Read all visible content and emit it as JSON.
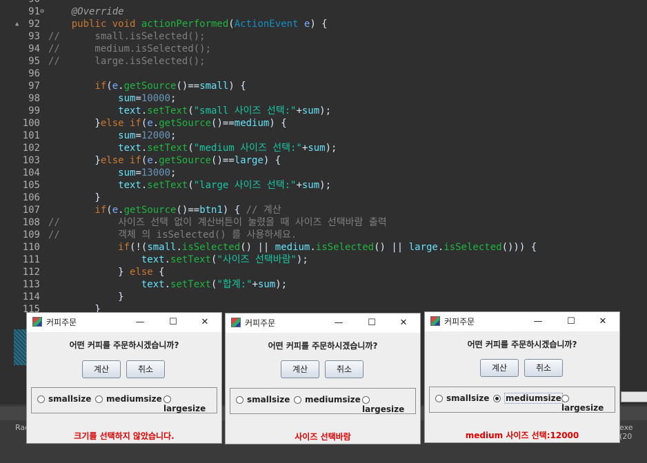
{
  "editor": {
    "lines": [
      {
        "n": "90",
        "tokens": []
      },
      {
        "n": "91",
        "mark": "",
        "fold": "⊖",
        "tokens": [
          [
            "t-ann",
            "    @Override"
          ]
        ]
      },
      {
        "n": "92",
        "mark": "▲",
        "tokens": [
          [
            "t-kw",
            "    public void "
          ],
          [
            "t-method",
            "actionPerformed"
          ],
          [
            "t-plain",
            "("
          ],
          [
            "t-type",
            "ActionEvent"
          ],
          [
            "t-param",
            " e"
          ],
          [
            "t-plain",
            ") {"
          ]
        ]
      },
      {
        "n": "93",
        "tokens": [
          [
            "t-comment",
            "//      small.isSelected();"
          ]
        ]
      },
      {
        "n": "94",
        "tokens": [
          [
            "t-comment",
            "//      medium.isSelected();"
          ]
        ]
      },
      {
        "n": "95",
        "tokens": [
          [
            "t-comment",
            "//      large.isSelected();"
          ]
        ]
      },
      {
        "n": "96",
        "tokens": []
      },
      {
        "n": "97",
        "tokens": [
          [
            "t-kw",
            "        if"
          ],
          [
            "t-plain",
            "("
          ],
          [
            "t-param",
            "e"
          ],
          [
            "t-plain",
            "."
          ],
          [
            "t-method",
            "getSource"
          ],
          [
            "t-plain",
            "()=="
          ],
          [
            "t-field",
            "small"
          ],
          [
            "t-plain",
            ") {"
          ]
        ]
      },
      {
        "n": "98",
        "tokens": [
          [
            "t-field",
            "            sum"
          ],
          [
            "t-plain",
            "="
          ],
          [
            "t-num",
            "10000"
          ],
          [
            "t-plain",
            ";"
          ]
        ]
      },
      {
        "n": "99",
        "tokens": [
          [
            "t-field",
            "            text"
          ],
          [
            "t-plain",
            "."
          ],
          [
            "t-method",
            "setText"
          ],
          [
            "t-plain",
            "("
          ],
          [
            "t-str",
            "\"small 사이즈 선택:\""
          ],
          [
            "t-plain",
            "+"
          ],
          [
            "t-field",
            "sum"
          ],
          [
            "t-plain",
            ");"
          ]
        ]
      },
      {
        "n": "100",
        "tokens": [
          [
            "t-plain",
            "        }"
          ],
          [
            "t-kw",
            "else if"
          ],
          [
            "t-plain",
            "("
          ],
          [
            "t-param",
            "e"
          ],
          [
            "t-plain",
            "."
          ],
          [
            "t-method",
            "getSource"
          ],
          [
            "t-plain",
            "()=="
          ],
          [
            "t-field",
            "medium"
          ],
          [
            "t-plain",
            ") {"
          ]
        ]
      },
      {
        "n": "101",
        "tokens": [
          [
            "t-field",
            "            sum"
          ],
          [
            "t-plain",
            "="
          ],
          [
            "t-num",
            "12000"
          ],
          [
            "t-plain",
            ";"
          ]
        ]
      },
      {
        "n": "102",
        "tokens": [
          [
            "t-field",
            "            text"
          ],
          [
            "t-plain",
            "."
          ],
          [
            "t-method",
            "setText"
          ],
          [
            "t-plain",
            "("
          ],
          [
            "t-str",
            "\"medium 사이즈 선택:\""
          ],
          [
            "t-plain",
            "+"
          ],
          [
            "t-field",
            "sum"
          ],
          [
            "t-plain",
            ");"
          ]
        ]
      },
      {
        "n": "103",
        "tokens": [
          [
            "t-plain",
            "        }"
          ],
          [
            "t-kw",
            "else if"
          ],
          [
            "t-plain",
            "("
          ],
          [
            "t-param",
            "e"
          ],
          [
            "t-plain",
            "."
          ],
          [
            "t-method",
            "getSource"
          ],
          [
            "t-plain",
            "()=="
          ],
          [
            "t-field",
            "large"
          ],
          [
            "t-plain",
            ") {"
          ]
        ]
      },
      {
        "n": "104",
        "tokens": [
          [
            "t-field",
            "            sum"
          ],
          [
            "t-plain",
            "="
          ],
          [
            "t-num",
            "13000"
          ],
          [
            "t-plain",
            ";"
          ]
        ]
      },
      {
        "n": "105",
        "tokens": [
          [
            "t-field",
            "            text"
          ],
          [
            "t-plain",
            "."
          ],
          [
            "t-method",
            "setText"
          ],
          [
            "t-plain",
            "("
          ],
          [
            "t-str",
            "\"large 사이즈 선택:\""
          ],
          [
            "t-plain",
            "+"
          ],
          [
            "t-field",
            "sum"
          ],
          [
            "t-plain",
            ");"
          ]
        ]
      },
      {
        "n": "106",
        "tokens": [
          [
            "t-plain",
            "        }"
          ]
        ]
      },
      {
        "n": "107",
        "tokens": [
          [
            "t-kw",
            "        if"
          ],
          [
            "t-plain",
            "("
          ],
          [
            "t-param",
            "e"
          ],
          [
            "t-plain",
            "."
          ],
          [
            "t-method",
            "getSource"
          ],
          [
            "t-plain",
            "()=="
          ],
          [
            "t-field",
            "btn1"
          ],
          [
            "t-plain",
            ") { "
          ],
          [
            "t-comment",
            "// 계산"
          ]
        ]
      },
      {
        "n": "108",
        "tokens": [
          [
            "t-comment",
            "//          사이즈 선택 없이 계산버튼이 눌렸을 때 사이즈 선택바람 출력"
          ]
        ]
      },
      {
        "n": "109",
        "tokens": [
          [
            "t-comment",
            "//          객체 의 isSelected() 를 사용하세요."
          ]
        ]
      },
      {
        "n": "110",
        "tokens": [
          [
            "t-kw",
            "            if"
          ],
          [
            "t-plain",
            "(!("
          ],
          [
            "t-field",
            "small"
          ],
          [
            "t-plain",
            "."
          ],
          [
            "t-method",
            "isSelected"
          ],
          [
            "t-plain",
            "() || "
          ],
          [
            "t-field",
            "medium"
          ],
          [
            "t-plain",
            "."
          ],
          [
            "t-method",
            "isSelected"
          ],
          [
            "t-plain",
            "() || "
          ],
          [
            "t-field",
            "large"
          ],
          [
            "t-plain",
            "."
          ],
          [
            "t-method",
            "isSelected"
          ],
          [
            "t-plain",
            "())) {"
          ]
        ]
      },
      {
        "n": "111",
        "tokens": [
          [
            "t-field",
            "                text"
          ],
          [
            "t-plain",
            "."
          ],
          [
            "t-method",
            "setText"
          ],
          [
            "t-plain",
            "("
          ],
          [
            "t-str",
            "\"사이즈 선택바람\""
          ],
          [
            "t-plain",
            ");"
          ]
        ]
      },
      {
        "n": "112",
        "tokens": [
          [
            "t-plain",
            "            } "
          ],
          [
            "t-kw",
            "else"
          ],
          [
            "t-plain",
            " {"
          ]
        ]
      },
      {
        "n": "113",
        "tokens": [
          [
            "t-field",
            "                text"
          ],
          [
            "t-plain",
            "."
          ],
          [
            "t-method",
            "setText"
          ],
          [
            "t-plain",
            "("
          ],
          [
            "t-str",
            "\"합계:\""
          ],
          [
            "t-plain",
            "+"
          ],
          [
            "t-field",
            "sum"
          ],
          [
            "t-plain",
            ");"
          ]
        ]
      },
      {
        "n": "114",
        "tokens": [
          [
            "t-plain",
            "            }"
          ]
        ]
      },
      {
        "n": "115",
        "tokens": [
          [
            "t-plain",
            "        }"
          ]
        ]
      }
    ]
  },
  "ide": {
    "console_left_text": "Rac",
    "console_right_text": "exe (20"
  },
  "dialogs": [
    {
      "title": "커피주문",
      "minimize": "—",
      "maximize": "☐",
      "close": "✕",
      "prompt": "어떤 커피를 주문하시겠습니까?",
      "calc_label": "계산",
      "cancel_label": "취소",
      "radios": [
        {
          "label": "smallsize",
          "selected": false
        },
        {
          "label": "mediumsize",
          "selected": false
        },
        {
          "label": "largesize",
          "selected": false
        }
      ],
      "status": "크기를 선택하지 않았습니다."
    },
    {
      "title": "커피주문",
      "minimize": "—",
      "maximize": "☐",
      "close": "✕",
      "prompt": "어떤 커피를 주문하시겠습니까?",
      "calc_label": "계산",
      "cancel_label": "취소",
      "radios": [
        {
          "label": "smallsize",
          "selected": false
        },
        {
          "label": "mediumsize",
          "selected": false
        },
        {
          "label": "largesize",
          "selected": false
        }
      ],
      "status": "사이즈 선택바람"
    },
    {
      "title": "커피주문",
      "minimize": "—",
      "maximize": "☐",
      "close": "✕",
      "prompt": "어떤 커피를 주문하시겠습니까?",
      "calc_label": "계산",
      "cancel_label": "취소",
      "radios": [
        {
          "label": "smallsize",
          "selected": false
        },
        {
          "label": "mediumsize",
          "selected": true
        },
        {
          "label": "largesize",
          "selected": false
        }
      ],
      "status": "medium 사이즈 선택:12000"
    }
  ]
}
